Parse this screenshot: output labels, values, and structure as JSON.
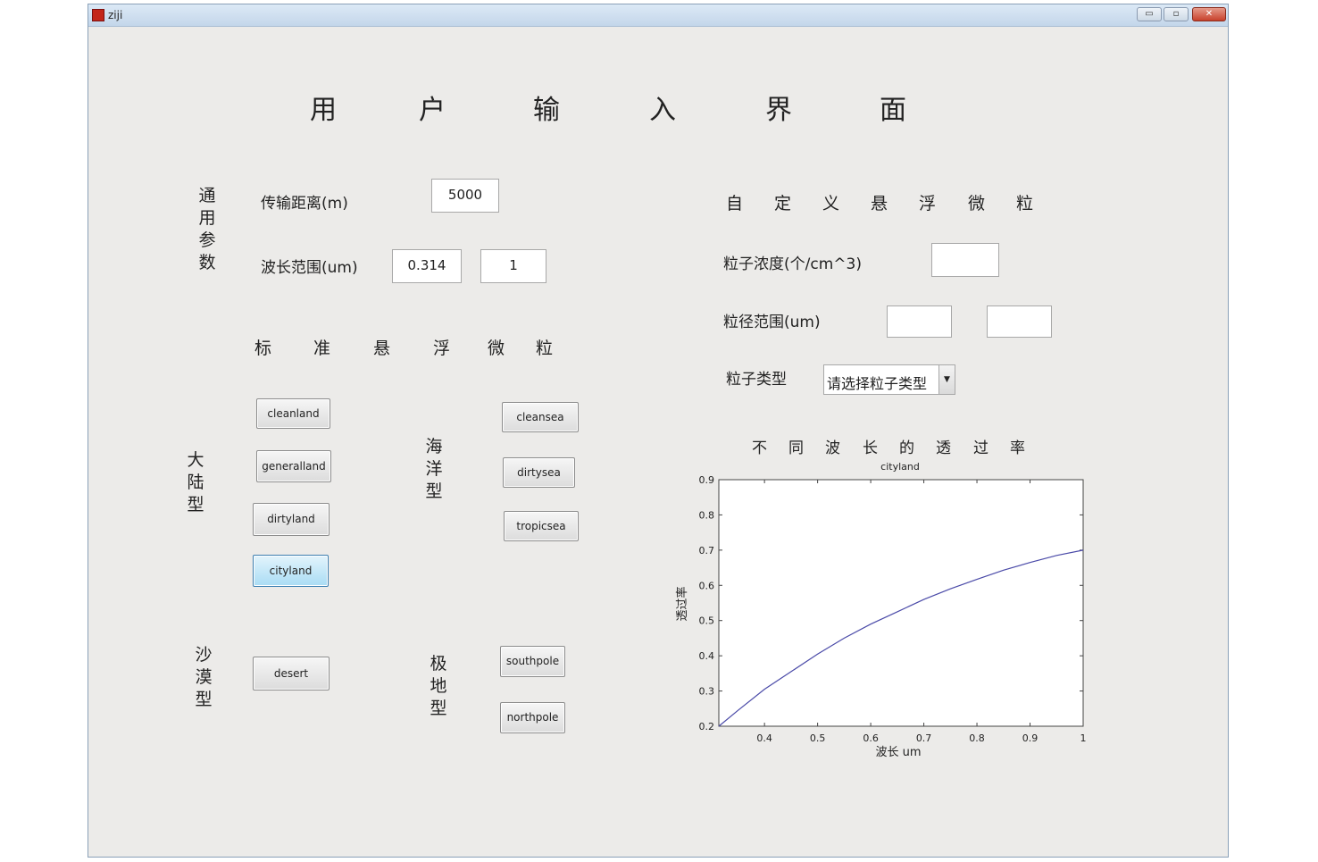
{
  "window": {
    "title": "ziji",
    "minimize": "▭",
    "maximize": "▫",
    "close": "✕"
  },
  "page_title": [
    "用",
    "户",
    "输",
    "入",
    "界",
    "面"
  ],
  "general": {
    "side_label": "通用参数",
    "distance_label": "传输距离(m)",
    "distance_value": "5000",
    "wavelength_label": "波长范围(um)",
    "wavelength_min": "0.314",
    "wavelength_max": "1"
  },
  "standard": {
    "heading": [
      "标",
      "准",
      "悬",
      "浮",
      "微",
      "粒"
    ],
    "continental_label": "大陆型",
    "continental_buttons": [
      "cleanland",
      "generalland",
      "dirtyland",
      "cityland"
    ],
    "maritime_label": "海洋型",
    "maritime_buttons": [
      "cleansea",
      "dirtysea",
      "tropicsea"
    ],
    "desert_label": "沙漠型",
    "desert_buttons": [
      "desert"
    ],
    "polar_label": "极地型",
    "polar_buttons": [
      "southpole",
      "northpole"
    ],
    "active_button": "cityland"
  },
  "custom": {
    "heading": [
      "自",
      "定",
      "义",
      "悬",
      "浮",
      "微",
      "粒"
    ],
    "concentration_label": "粒子浓度(个/cm^3)",
    "concentration_value": "",
    "size_label": "粒径范围(um)",
    "size_min": "",
    "size_max": "",
    "type_label": "粒子类型",
    "type_selected": "请选择粒子类型"
  },
  "chart_caption": [
    "不",
    "同",
    "波",
    "长",
    "的",
    "透",
    "过",
    "率"
  ],
  "chart_data": {
    "type": "line",
    "title": "cityland",
    "xlabel": "波长      um",
    "ylabel": "透过率",
    "xlim": [
      0.314,
      1
    ],
    "ylim": [
      0.2,
      0.9
    ],
    "xticks": [
      "0.4",
      "0.5",
      "0.6",
      "0.7",
      "0.8",
      "0.9",
      "1"
    ],
    "yticks": [
      "0.9",
      "0.8",
      "0.7",
      "0.6",
      "0.5",
      "0.4",
      "0.3",
      "0.2"
    ],
    "color": "#4a4aa8",
    "x": [
      0.314,
      0.35,
      0.4,
      0.45,
      0.5,
      0.55,
      0.6,
      0.65,
      0.7,
      0.75,
      0.8,
      0.85,
      0.9,
      0.95,
      1.0
    ],
    "y": [
      0.2,
      0.245,
      0.305,
      0.355,
      0.405,
      0.45,
      0.49,
      0.525,
      0.56,
      0.59,
      0.617,
      0.643,
      0.665,
      0.685,
      0.7
    ]
  }
}
